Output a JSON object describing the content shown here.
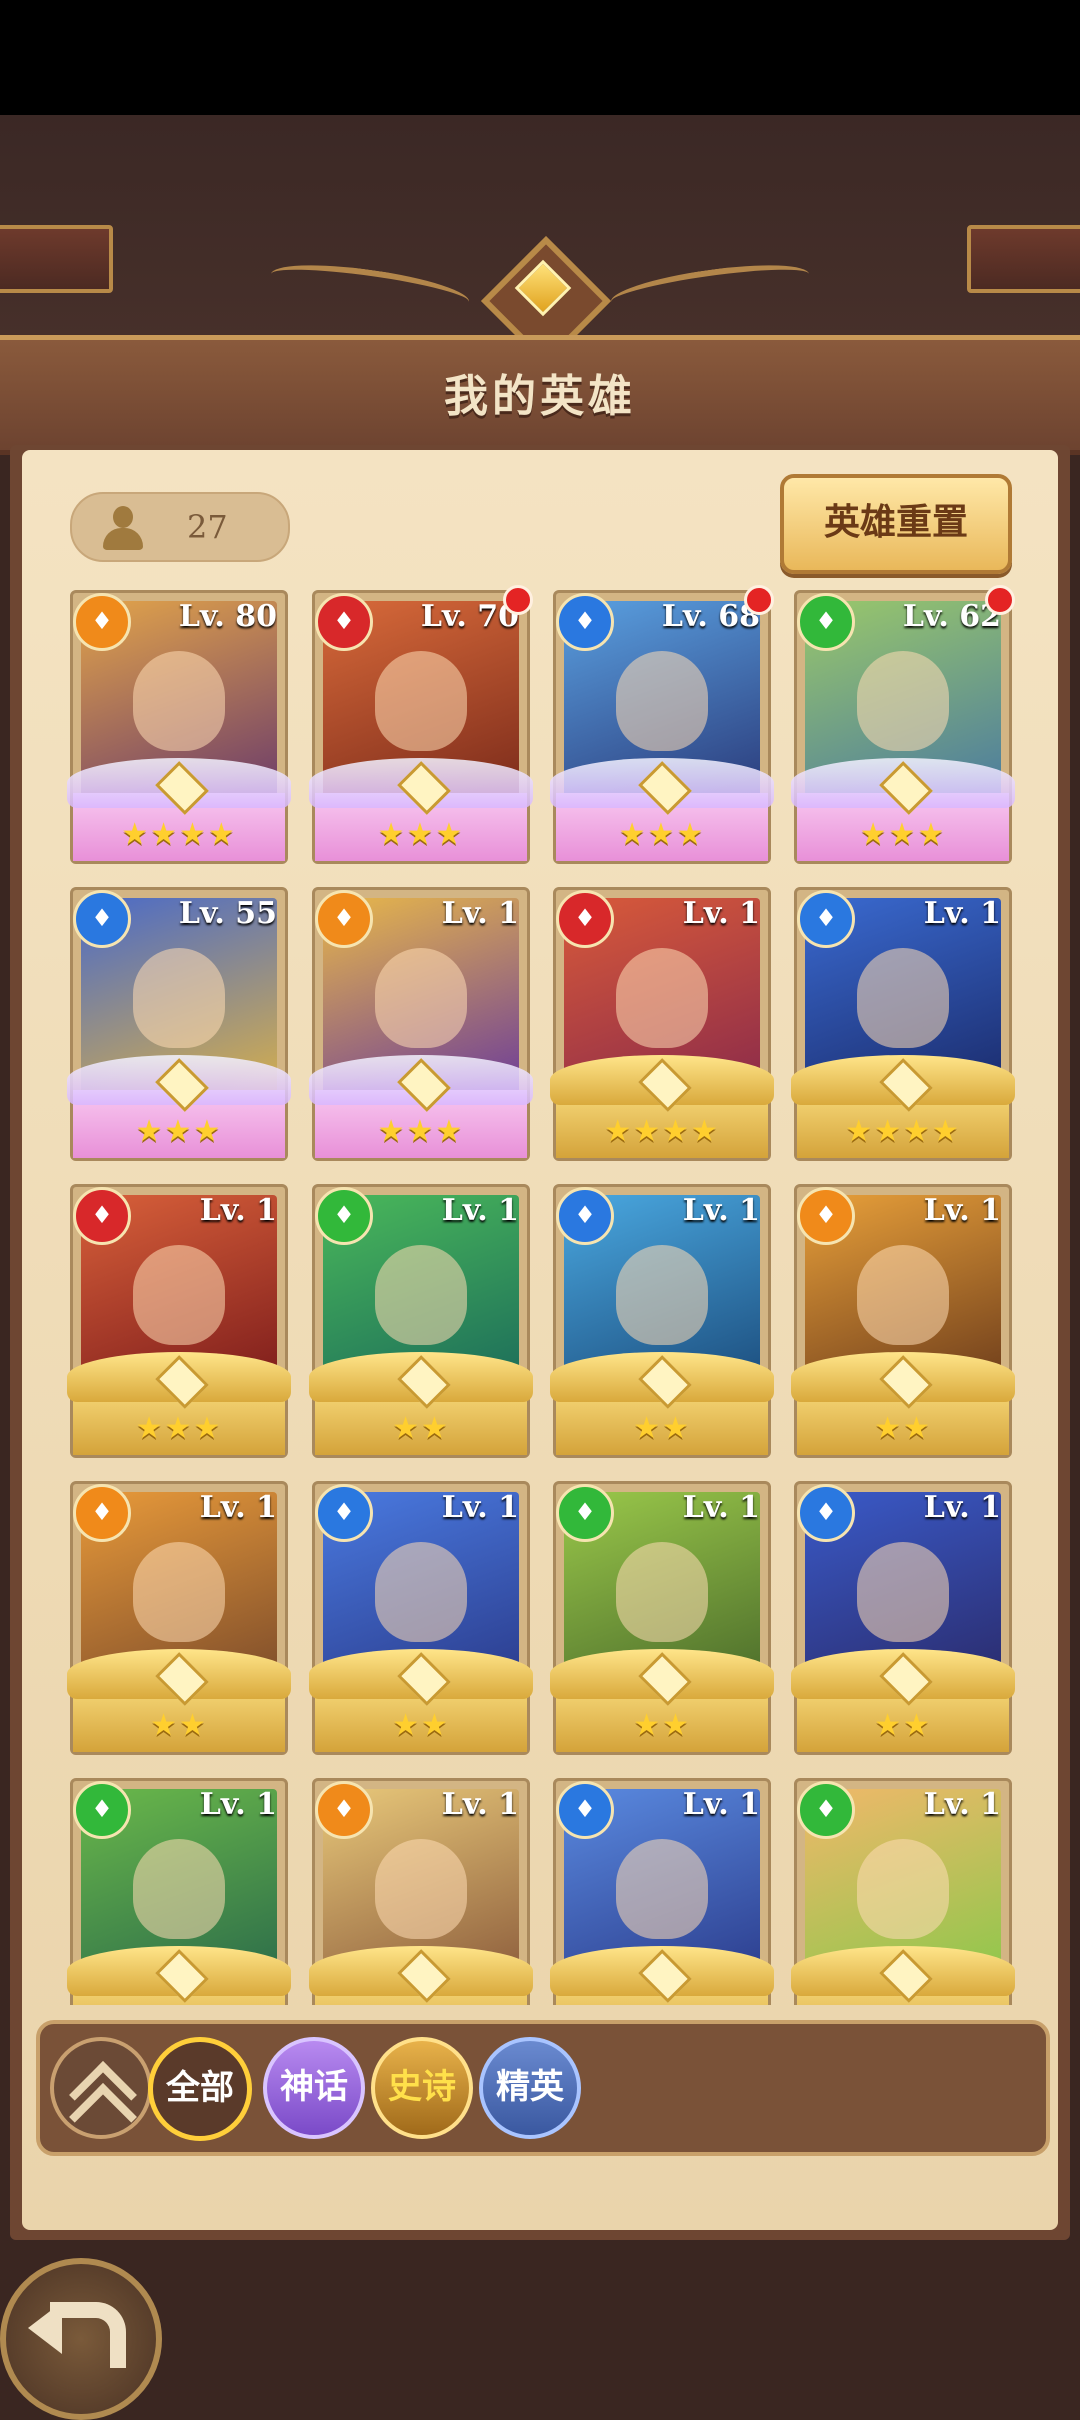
{
  "page_title": "我的英雄",
  "hero_count": "27",
  "reset_button": "英雄重置",
  "star": "★",
  "heroes": [
    {
      "level": "Lv. 80",
      "faction": "orange",
      "stars": "★★★★",
      "base": "mythic",
      "portrait": [
        "#e2a44a",
        "#6a3a6a"
      ],
      "notify": false
    },
    {
      "level": "Lv. 70",
      "faction": "red",
      "stars": "★★★",
      "base": "mythic",
      "portrait": [
        "#d86a3a",
        "#7a2a1a"
      ],
      "notify": true
    },
    {
      "level": "Lv. 68",
      "faction": "blue",
      "stars": "★★★",
      "base": "mythic",
      "portrait": [
        "#5aa0e0",
        "#2a3a7a"
      ],
      "notify": true
    },
    {
      "level": "Lv. 62",
      "faction": "green",
      "stars": "★★★",
      "base": "mythic",
      "portrait": [
        "#9ac86a",
        "#4a7aa0"
      ],
      "notify": true
    },
    {
      "level": "Lv. 55",
      "faction": "blue",
      "stars": "★★★",
      "base": "mythic",
      "portrait": [
        "#4a6ac8",
        "#d8b04a"
      ],
      "notify": false
    },
    {
      "level": "Lv. 1",
      "faction": "orange",
      "stars": "★★★",
      "base": "mythic",
      "portrait": [
        "#e8b84a",
        "#6a3a9a"
      ],
      "notify": false
    },
    {
      "level": "Lv. 1",
      "faction": "red",
      "stars": "★★★★",
      "base": "gold",
      "portrait": [
        "#d85a3a",
        "#8a2a4a"
      ],
      "notify": false
    },
    {
      "level": "Lv. 1",
      "faction": "blue",
      "stars": "★★★★",
      "base": "gold",
      "portrait": [
        "#3a6ad0",
        "#1a2a6a"
      ],
      "notify": false
    },
    {
      "level": "Lv. 1",
      "faction": "red",
      "stars": "★★★",
      "base": "gold",
      "portrait": [
        "#d8603a",
        "#7a1a1a"
      ],
      "notify": false
    },
    {
      "level": "Lv. 1",
      "faction": "green",
      "stars": "★★",
      "base": "gold",
      "portrait": [
        "#4ab85a",
        "#1a6a5a"
      ],
      "notify": false
    },
    {
      "level": "Lv. 1",
      "faction": "blue",
      "stars": "★★",
      "base": "gold",
      "portrait": [
        "#4aa8e0",
        "#1a4a7a"
      ],
      "notify": false
    },
    {
      "level": "Lv. 1",
      "faction": "orange",
      "stars": "★★",
      "base": "gold",
      "portrait": [
        "#e8a03a",
        "#6a3a1a"
      ],
      "notify": false
    },
    {
      "level": "Lv. 1",
      "faction": "orange",
      "stars": "★★",
      "base": "gold",
      "portrait": [
        "#e89a3a",
        "#7a4a2a"
      ],
      "notify": false
    },
    {
      "level": "Lv. 1",
      "faction": "blue",
      "stars": "★★",
      "base": "gold",
      "portrait": [
        "#4a7ae0",
        "#2a3a8a"
      ],
      "notify": false
    },
    {
      "level": "Lv. 1",
      "faction": "green",
      "stars": "★★",
      "base": "gold",
      "portrait": [
        "#9ac84a",
        "#4a6a2a"
      ],
      "notify": false
    },
    {
      "level": "Lv. 1",
      "faction": "blue",
      "stars": "★★",
      "base": "gold",
      "portrait": [
        "#3a5ac8",
        "#2a2a6a"
      ],
      "notify": false
    },
    {
      "level": "Lv. 1",
      "faction": "green",
      "stars": "",
      "base": "gold",
      "portrait": [
        "#6ab84a",
        "#2a6a4a"
      ],
      "notify": false
    },
    {
      "level": "Lv. 1",
      "faction": "orange",
      "stars": "",
      "base": "gold",
      "portrait": [
        "#e8c87a",
        "#8a5a3a"
      ],
      "notify": false
    },
    {
      "level": "Lv. 1",
      "faction": "blue",
      "stars": "",
      "base": "gold",
      "portrait": [
        "#5a8ae0",
        "#2a3a8a"
      ],
      "notify": false
    },
    {
      "level": "Lv. 1",
      "faction": "green",
      "stars": "",
      "base": "gold",
      "portrait": [
        "#f0b86a",
        "#8ac84a"
      ],
      "notify": false
    }
  ],
  "filters": {
    "all": "全部",
    "mythic": "神话",
    "epic": "史诗",
    "elite": "精英"
  },
  "colors": {
    "parchment": "#f4e3c2",
    "accent_gold": "#ffcf3a",
    "notify_red": "#e42424"
  }
}
